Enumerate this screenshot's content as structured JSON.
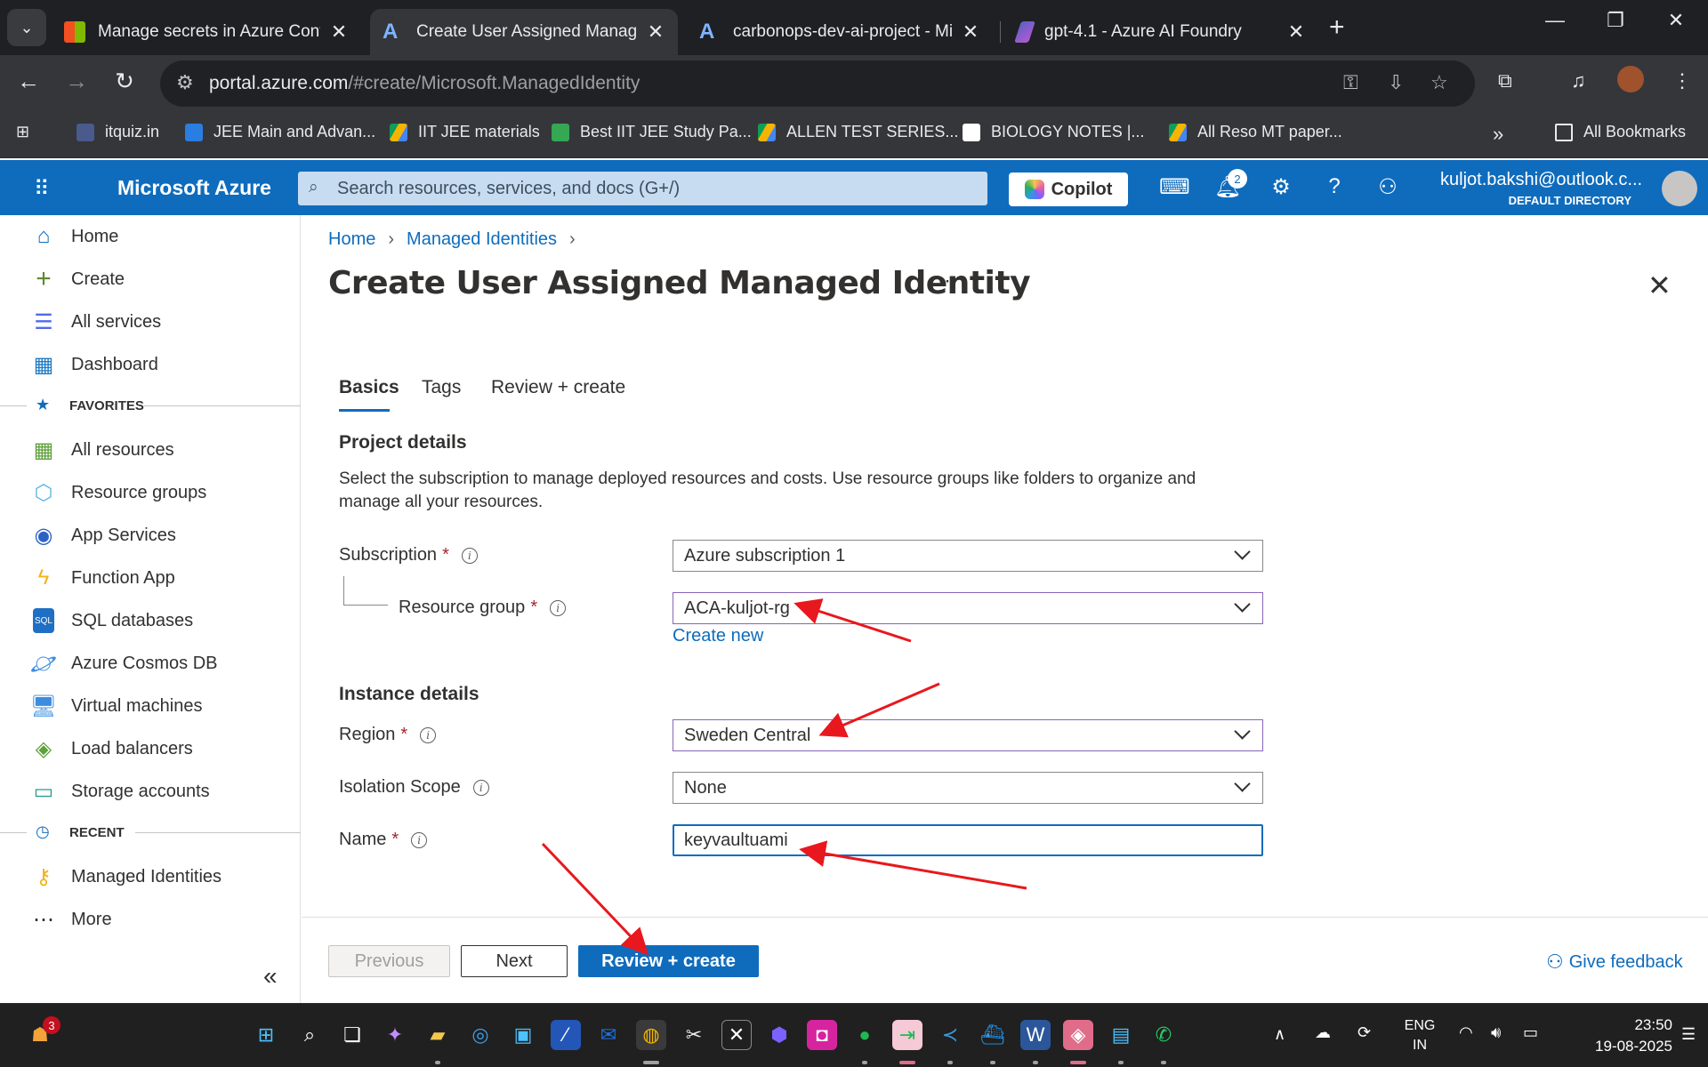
{
  "browser": {
    "tabs": [
      {
        "title": "Manage secrets in Azure Conta",
        "active": false
      },
      {
        "title": "Create User Assigned Managed",
        "active": true
      },
      {
        "title": "carbonops-dev-ai-project - Mic",
        "active": false
      },
      {
        "title": "gpt-4.1 - Azure AI Foundry",
        "active": false
      }
    ],
    "url_host": "portal.azure.com",
    "url_path": "/#create/Microsoft.ManagedIdentity",
    "bookmarks": [
      "itquiz.in",
      "JEE Main and Advan...",
      "IIT JEE materials",
      "Best IIT JEE Study Pa...",
      "ALLEN TEST SERIES...",
      "BIOLOGY NOTES |...",
      "All Reso MT paper..."
    ],
    "all_bookmarks": "All Bookmarks"
  },
  "azure": {
    "brand": "Microsoft Azure",
    "search_placeholder": "Search resources, services, and docs (G+/)",
    "copilot_label": "Copilot",
    "notification_count": "2",
    "account_email": "kuljot.bakshi@outlook.c...",
    "account_directory": "DEFAULT DIRECTORY"
  },
  "sidebar": {
    "items_top": [
      {
        "label": "Home",
        "icon": "home-icon"
      },
      {
        "label": "Create",
        "icon": "plus-icon"
      },
      {
        "label": "All services",
        "icon": "list-icon"
      },
      {
        "label": "Dashboard",
        "icon": "dashboard-icon"
      }
    ],
    "favorites_label": "FAVORITES",
    "favorites": [
      {
        "label": "All resources",
        "icon": "grid-icon"
      },
      {
        "label": "Resource groups",
        "icon": "cube-icon"
      },
      {
        "label": "App Services",
        "icon": "globe-icon"
      },
      {
        "label": "Function App",
        "icon": "lightning-icon"
      },
      {
        "label": "SQL databases",
        "icon": "sql-icon"
      },
      {
        "label": "Azure Cosmos DB",
        "icon": "planet-icon"
      },
      {
        "label": "Virtual machines",
        "icon": "monitor-icon"
      },
      {
        "label": "Load balancers",
        "icon": "diamond-icon"
      },
      {
        "label": "Storage accounts",
        "icon": "storage-icon"
      }
    ],
    "recent_label": "RECENT",
    "recent": [
      {
        "label": "Managed Identities",
        "icon": "key-icon"
      }
    ],
    "more_label": "More"
  },
  "main": {
    "breadcrumb": [
      "Home",
      "Managed Identities"
    ],
    "title": "Create User Assigned Managed Identity",
    "tabs": [
      "Basics",
      "Tags",
      "Review + create"
    ],
    "project_details_heading": "Project details",
    "description": "Select the subscription to manage deployed resources and costs. Use resource groups like folders to organize and manage all your resources.",
    "subscription_label": "Subscription",
    "subscription_value": "Azure subscription 1",
    "resource_group_label": "Resource group",
    "resource_group_value": "ACA-kuljot-rg",
    "create_new": "Create new",
    "instance_details_heading": "Instance details",
    "region_label": "Region",
    "region_value": "Sweden Central",
    "isolation_label": "Isolation Scope",
    "isolation_value": "None",
    "name_label": "Name",
    "name_value": "keyvaultuami"
  },
  "footer": {
    "previous": "Previous",
    "next": "Next",
    "review_create": "Review + create",
    "feedback": "Give feedback"
  },
  "taskbar": {
    "notification_badge": "3",
    "lang_line1": "ENG",
    "lang_line2": "IN",
    "time": "23:50",
    "date": "19-08-2025"
  },
  "colors": {
    "azure_blue": "#0f6cbd",
    "required_red": "#a4262c",
    "accent_purple": "#8764b8",
    "annotation_red": "#e8181e"
  }
}
